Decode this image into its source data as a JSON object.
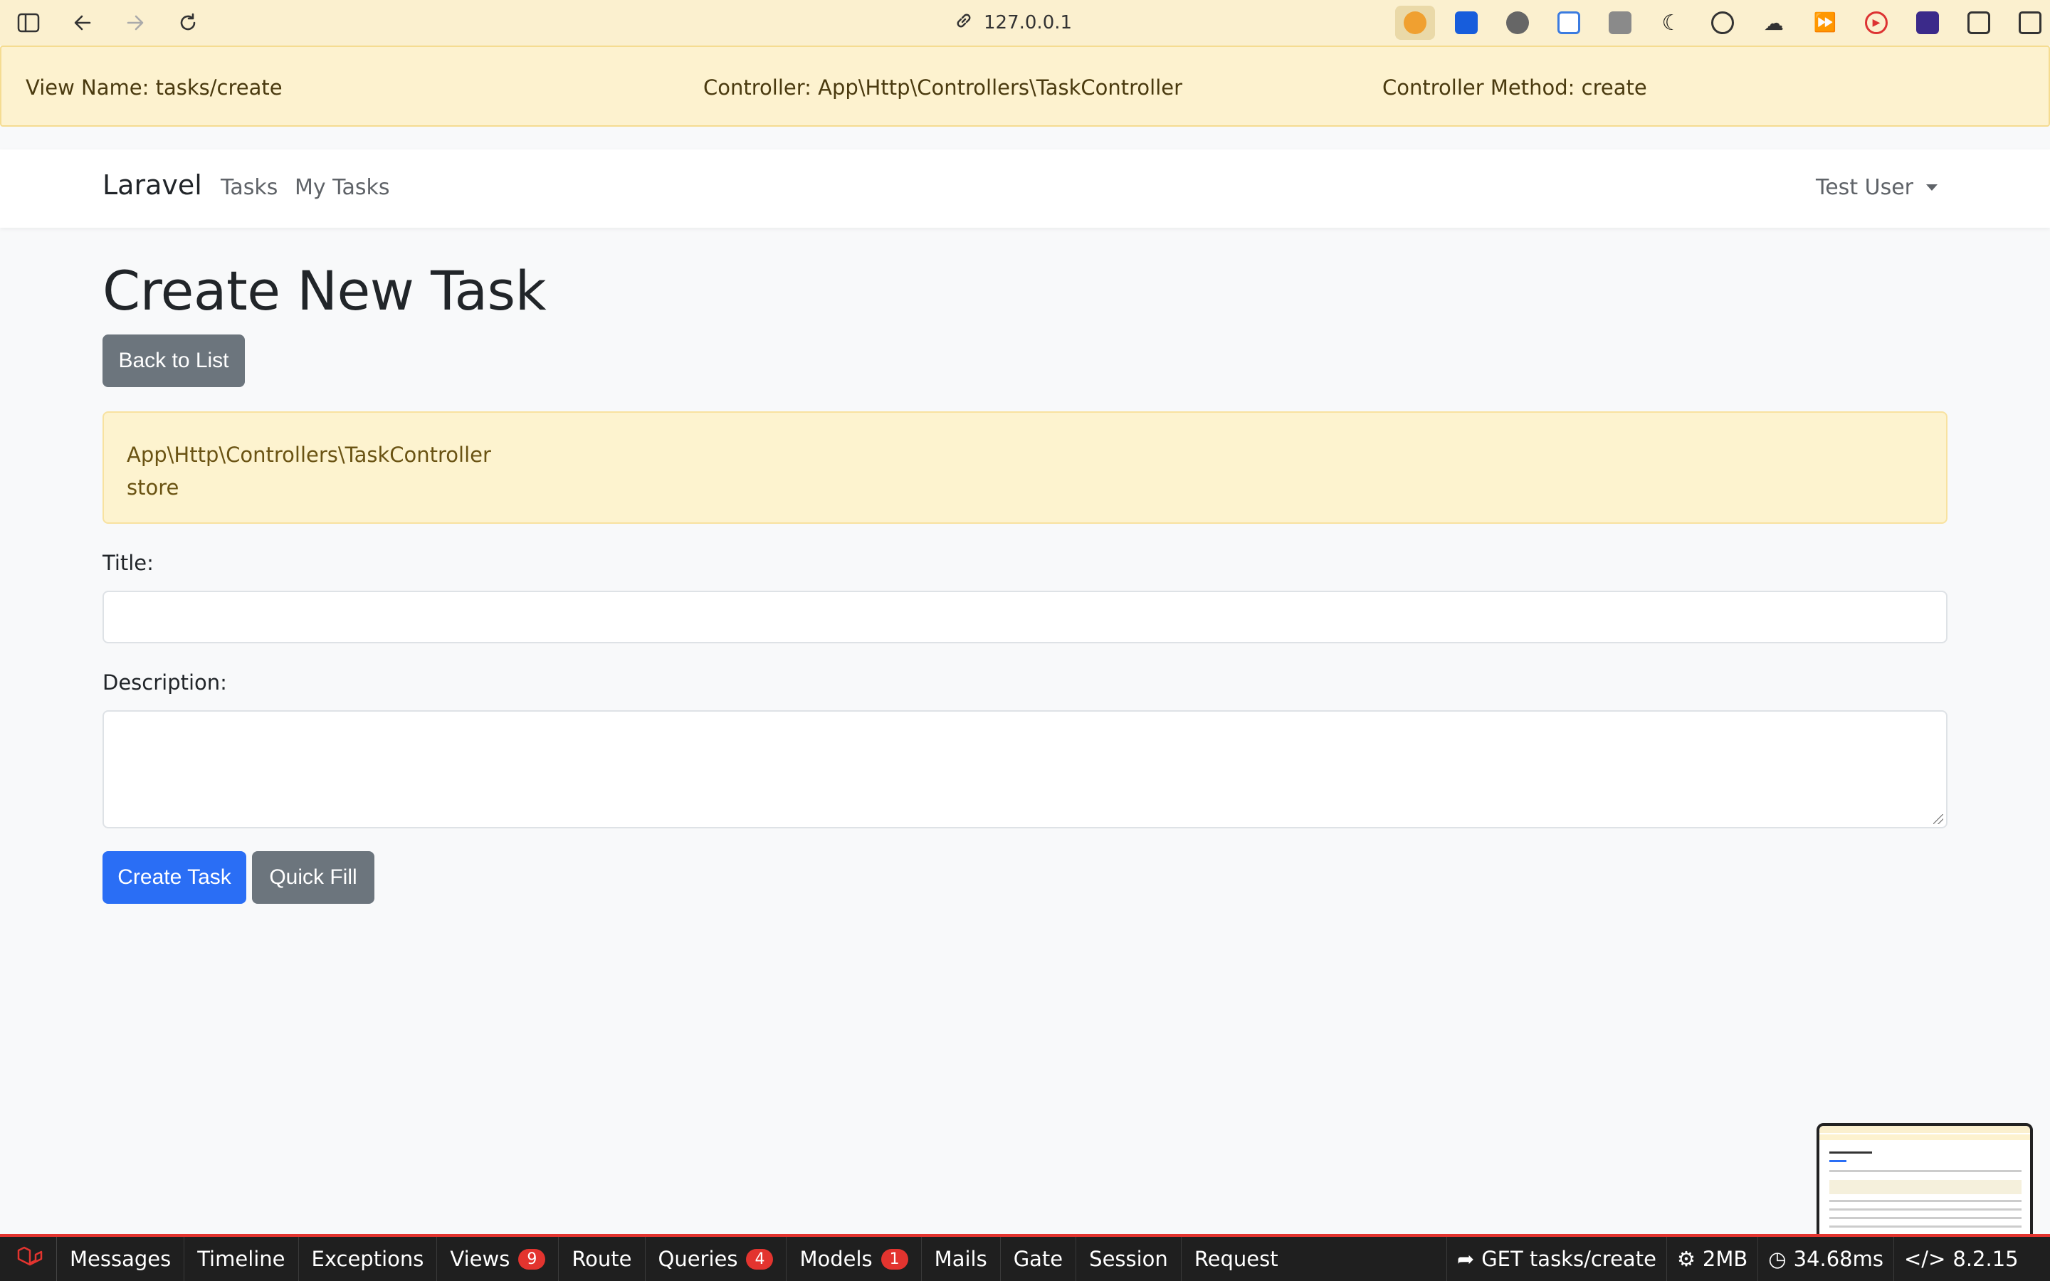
{
  "browser": {
    "url": "127.0.0.1",
    "extensions": [
      "timer-icon",
      "bitwarden-icon",
      "avatar-icon",
      "calendar-icon",
      "copy-icon",
      "moon-icon",
      "braces-icon",
      "cloud-icon",
      "fast-forward-icon",
      "play-icon",
      "graduation-cap-icon",
      "settings-icon",
      "sidebar-icon"
    ]
  },
  "dev_bar": {
    "view_name": "View Name: tasks/create",
    "controller": "Controller: App\\Http\\Controllers\\TaskController",
    "method": "Controller Method: create"
  },
  "navbar": {
    "brand": "Laravel",
    "links": [
      "Tasks",
      "My Tasks"
    ],
    "user": "Test User"
  },
  "main": {
    "title": "Create New Task",
    "back_button": "Back to List",
    "alert_line1": "App\\Http\\Controllers\\TaskController",
    "alert_line2": "store",
    "title_label": "Title:",
    "title_value": "",
    "description_label": "Description:",
    "description_value": "",
    "create_button": "Create Task",
    "quick_fill_button": "Quick Fill"
  },
  "debugbar": {
    "tabs": [
      {
        "label": "Messages"
      },
      {
        "label": "Timeline"
      },
      {
        "label": "Exceptions"
      },
      {
        "label": "Views",
        "badge": "9"
      },
      {
        "label": "Route"
      },
      {
        "label": "Queries",
        "badge": "4"
      },
      {
        "label": "Models",
        "badge": "1"
      },
      {
        "label": "Mails"
      },
      {
        "label": "Gate"
      },
      {
        "label": "Session"
      },
      {
        "label": "Request"
      }
    ],
    "route": "GET tasks/create",
    "memory": "2MB",
    "time": "34.68ms",
    "php": "8.2.15"
  },
  "colors": {
    "primary": "#2a6ef5",
    "secondary": "#6c757d",
    "warning_bg": "#fdf3cf",
    "debug_accent": "#e3342f"
  }
}
